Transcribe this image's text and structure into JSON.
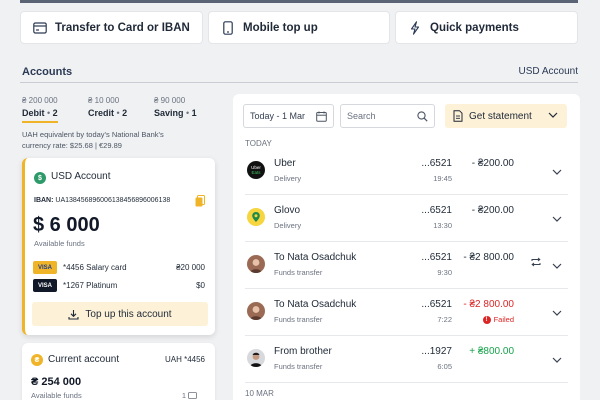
{
  "quick_actions": [
    {
      "label": "Transfer to Card or IBAN",
      "icon": "card-icon"
    },
    {
      "label": "Mobile top up",
      "icon": "phone-icon"
    },
    {
      "label": "Quick payments",
      "icon": "lightning-icon"
    }
  ],
  "accounts": {
    "title": "Accounts",
    "currency_label": "USD Account",
    "balances": [
      {
        "amount": "₴ 200 000",
        "label": "Debit",
        "count": "2"
      },
      {
        "amount": "₴ 10 000",
        "label": "Credit",
        "count": "2"
      },
      {
        "amount": "₴ 90 000",
        "label": "Saving",
        "count": "1"
      }
    ],
    "rate_line1": "UAH equivalent by today's National Bank's",
    "rate_line2": "currency rate: $25.68 | €29.89",
    "active_card": {
      "name": "USD Account",
      "coin_symbol": "$",
      "iban_label": "IBAN:",
      "iban": "UA138456896006138456896006138",
      "balance": "$ 6 000",
      "balance_caption": "Available funds",
      "cards": [
        {
          "brand": "VISA",
          "number": "*4456 Salary card",
          "amount": "₴20 000"
        },
        {
          "brand": "VISA",
          "number": "*1267 Platinum",
          "amount": "$0"
        }
      ],
      "top_up_label": "Top up this account"
    },
    "second_card": {
      "name": "Current account",
      "coin_symbol": "₴",
      "number": "UAH *4456",
      "balance": "₴ 254 000",
      "balance_caption": "Available funds",
      "extra": "1"
    }
  },
  "transactions": {
    "date_filter": "Today - 1 Mar",
    "search_placeholder": "Search",
    "statement_label": "Get statement",
    "groups": [
      {
        "day": "TODAY"
      },
      {
        "day": "10 MAR"
      }
    ],
    "items": [
      {
        "name": "Uber",
        "sub": "Delivery",
        "card": "...6521",
        "time": "19:45",
        "amount": "- ₴200.00",
        "status": "normal",
        "logo": "Uber Eats"
      },
      {
        "name": "Glovo",
        "sub": "Delivery",
        "card": "...6521",
        "time": "13:30",
        "amount": "- ₴200.00",
        "status": "normal",
        "logo": "glovo"
      },
      {
        "name": "To Nata Osadchuk",
        "sub": "Funds transfer",
        "card": "...6521",
        "time": "9:30",
        "amount": "- ₴2 800.00",
        "status": "normal",
        "logo": "avatar"
      },
      {
        "name": "To Nata Osadchuk",
        "sub": "Funds transfer",
        "card": "...6521",
        "time": "7:22",
        "amount": "- ₴2 800.00",
        "status": "failed",
        "status_label": "Failed",
        "logo": "avatar"
      },
      {
        "name": "From brother",
        "sub": "Funds transfer",
        "card": "...1927",
        "time": "6:05",
        "amount": "+ ₴800.00",
        "status": "income",
        "logo": "avatar"
      }
    ]
  },
  "colors": {
    "accent": "#f0b429",
    "income": "#16a34a",
    "failed": "#dc2626",
    "navy": "#2b3a55"
  }
}
